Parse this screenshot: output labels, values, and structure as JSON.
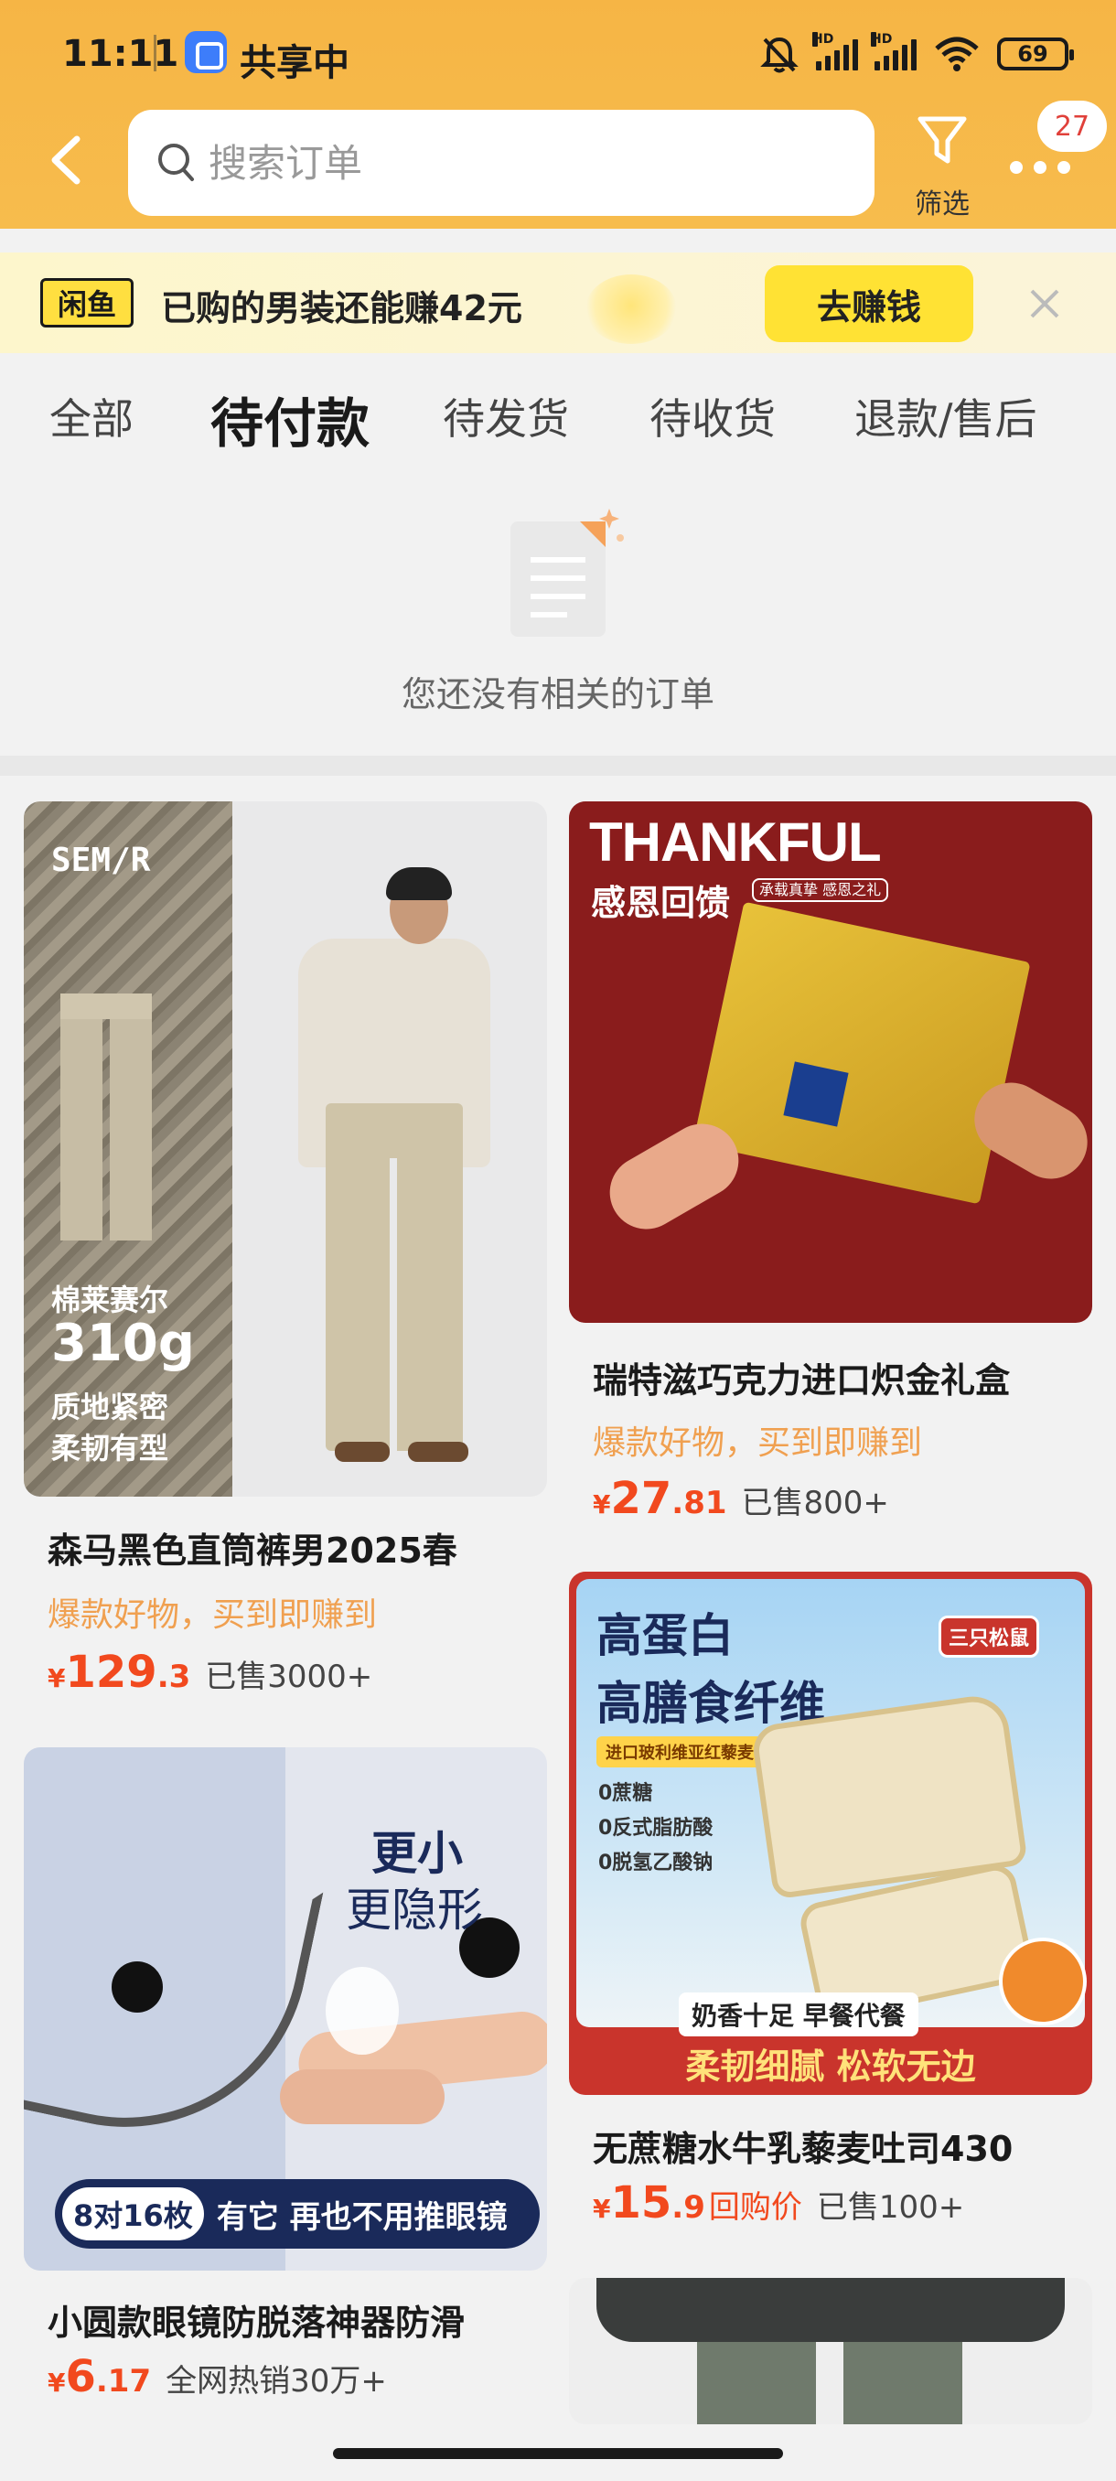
{
  "status_bar": {
    "time": "11:11",
    "share_label": "共享中",
    "signal1_tag": "HD",
    "signal2_tag": "HD",
    "battery": "69"
  },
  "header": {
    "search_placeholder": "搜索订单",
    "filter_label": "筛选",
    "message_count": "27"
  },
  "banner": {
    "logo_text": "闲鱼",
    "text": "已购的男装还能赚42元",
    "button": "去赚钱"
  },
  "tabs": [
    {
      "label": "全部",
      "active": false
    },
    {
      "label": "待付款",
      "active": true
    },
    {
      "label": "待发货",
      "active": false
    },
    {
      "label": "待收货",
      "active": false
    },
    {
      "label": "退款/售后",
      "active": false
    }
  ],
  "empty_state": {
    "text": "您还没有相关的订单"
  },
  "products": [
    {
      "title": "森马黑色直筒裤男2025春",
      "promo": "爆款好物，买到即赚到",
      "currency": "¥",
      "price_int": "129",
      "price_dec": ".3",
      "sold": "已售3000+",
      "image_text": {
        "brand": "SEM/R",
        "line1": "棉莱赛尔",
        "line2": "310g",
        "line3": "质地紧密",
        "line4": "柔韧有型"
      }
    },
    {
      "title": "瑞特滋巧克力进口炽金礼盒",
      "promo": "爆款好物，买到即赚到",
      "currency": "¥",
      "price_int": "27",
      "price_dec": ".81",
      "sold": "已售800+",
      "image_text": {
        "headline": "THANKFUL",
        "sub": "感恩回馈",
        "tag": "承载真挚 感恩之礼"
      }
    },
    {
      "title": "无蔗糖水牛乳藜麦吐司430",
      "promo": "",
      "currency": "¥",
      "price_int": "15",
      "price_dec": ".9",
      "price_tag": "回购价",
      "sold": "已售100+",
      "image_text": {
        "line1": "高蛋白",
        "line2": "高膳食纤维",
        "chip": "进口玻利维亚红藜麦",
        "point1": "0蔗糖",
        "point2": "0反式脂肪酸",
        "point3": "0脱氢乙酸钠",
        "brand": "三只松鼠",
        "label": "奶香十足 早餐代餐",
        "footer": "柔韧细腻 松软无边"
      }
    },
    {
      "title": "小圆款眼镜防脱落神器防滑",
      "promo": "",
      "currency": "¥",
      "price_int": "6",
      "price_dec": ".17",
      "sold": "全网热销30万+",
      "image_text": {
        "line1": "更小",
        "line2": "更隐形",
        "qty": "8对16枚",
        "desc": "有它 再也不用推眼镜"
      }
    }
  ],
  "colors": {
    "header": "#f6b545",
    "price": "#f2491e",
    "promo": "#f0a050",
    "earn_button": "#ffe234"
  }
}
